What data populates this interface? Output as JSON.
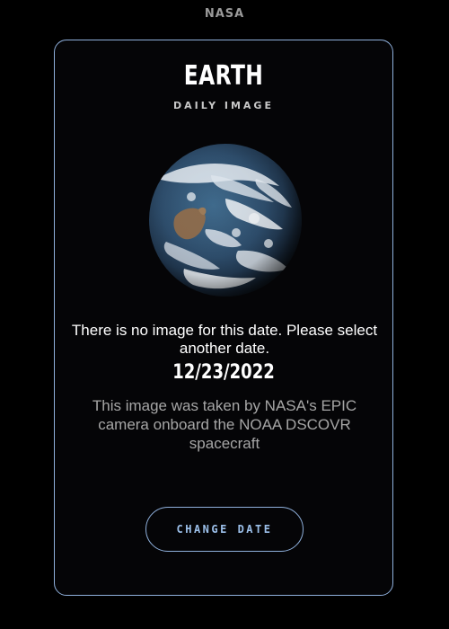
{
  "logo": {
    "text": "NASA"
  },
  "card": {
    "title": "EARTH",
    "subtitle": "DAILY IMAGE",
    "message": "There is no image for this date. Please select another date.",
    "date": "12/23/2022",
    "caption": "This image was taken by NASA's EPIC camera onboard the NOAA DSCOVR spacecraft",
    "button_label": "CHANGE DATE"
  },
  "colors": {
    "background": "#000000",
    "card_border": "#8fb0dc",
    "accent": "#9cc0ea",
    "caption_text": "#a6a6a6"
  },
  "icons": {
    "earth": "earth-globe-image"
  }
}
